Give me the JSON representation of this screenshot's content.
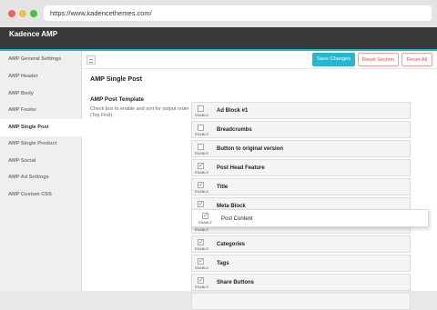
{
  "browser": {
    "url": "https://www.kadencethemes.com/"
  },
  "app": {
    "title": "Kadence AMP",
    "accent_color": "#22b8d1",
    "header_color": "#3a3a3a"
  },
  "sidebar": {
    "items": [
      {
        "label": "AMP General Settings",
        "active": false
      },
      {
        "label": "AMP Header",
        "active": false
      },
      {
        "label": "AMP Body",
        "active": false
      },
      {
        "label": "AMP Footer",
        "active": false
      },
      {
        "label": "AMP Single Post",
        "active": true
      },
      {
        "label": "AMP Single Product",
        "active": false
      },
      {
        "label": "AMP Social",
        "active": false
      },
      {
        "label": "AMP Ad Settings",
        "active": false
      },
      {
        "label": "AMP Custom CSS",
        "active": false
      }
    ]
  },
  "toolbar": {
    "save_label": "Save Changes",
    "reset_section_label": "Reset Section",
    "reset_all_label": "Reset All",
    "save_color": "#27b5cf",
    "reset_color": "#d9534f"
  },
  "main": {
    "heading": "AMP Single Post",
    "section_label": "AMP Post Template",
    "section_desc": "Check box to enable and sort for output order (Top First).",
    "enable_label": "ENABLE",
    "blocks": [
      {
        "label": "Ad Block #1",
        "checked": false
      },
      {
        "label": "Breadcrumbs",
        "checked": false
      },
      {
        "label": "Button to original version",
        "checked": false
      },
      {
        "label": "Post Head Feature",
        "checked": true
      },
      {
        "label": "Title",
        "checked": true
      },
      {
        "label": "Meta Block",
        "checked": true
      },
      {
        "label": "",
        "checked": false
      },
      {
        "label": "Categories",
        "checked": true
      },
      {
        "label": "Tags",
        "checked": true
      },
      {
        "label": "Share Buttons",
        "checked": true
      }
    ],
    "dragging_block": {
      "label": "Post Content",
      "checked": true
    }
  }
}
